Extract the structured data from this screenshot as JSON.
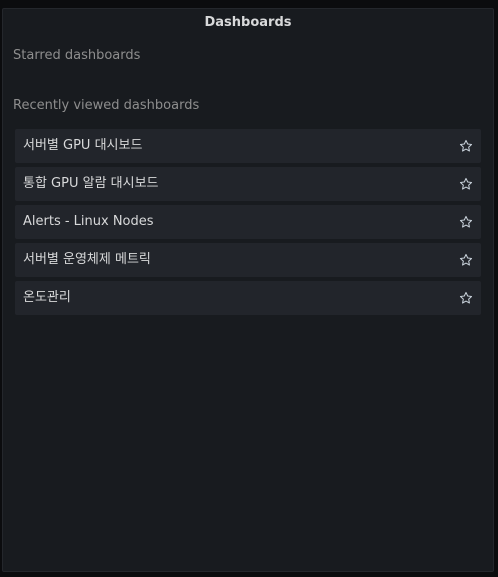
{
  "panel": {
    "title": "Dashboards",
    "starred_heading": "Starred dashboards",
    "recent_heading": "Recently viewed dashboards"
  },
  "recent": [
    {
      "label": "서버별 GPU 대시보드",
      "icon": "star-outline-icon"
    },
    {
      "label": "통합 GPU 알람 대시보드",
      "icon": "star-outline-icon"
    },
    {
      "label": "Alerts - Linux Nodes",
      "icon": "star-outline-icon"
    },
    {
      "label": "서버별 운영체제 메트릭",
      "icon": "star-outline-icon"
    },
    {
      "label": "온도관리",
      "icon": "star-outline-icon"
    }
  ],
  "colors": {
    "background": "#0b0c0e",
    "panel": "#181b1f",
    "item": "#22252b",
    "text": "#d8d9da",
    "muted": "#8e8e8e"
  }
}
